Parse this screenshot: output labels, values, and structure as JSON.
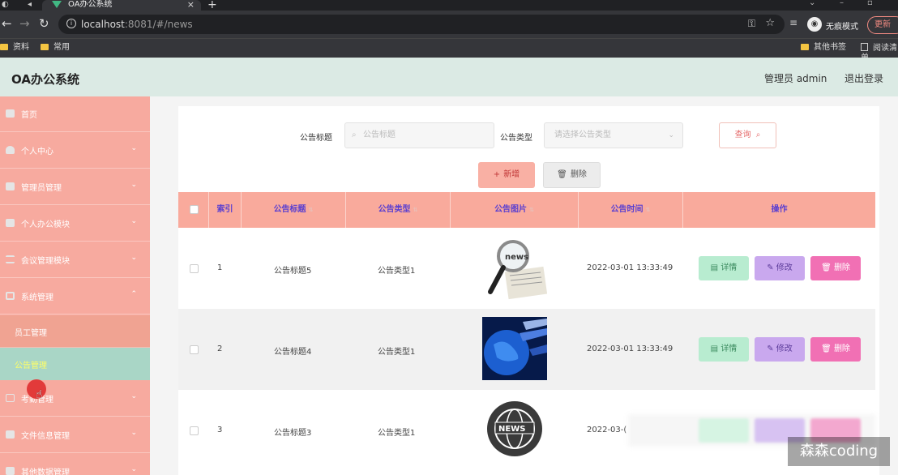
{
  "browser": {
    "tab_title": "OA办公系统",
    "url_host": "localhost",
    "url_rest": ":8081/#/news",
    "incognito_label": "无痕模式",
    "update_label": "更新",
    "bookmarks": [
      "资料",
      "常用"
    ],
    "bookmarks_right": [
      "其他书签",
      "阅读清单"
    ]
  },
  "header": {
    "title": "OA办公系统",
    "user": "管理员 admin",
    "logout": "退出登录"
  },
  "sidebar": {
    "items": [
      {
        "label": "首页",
        "icon": "home-icon"
      },
      {
        "label": "个人中心",
        "icon": "user-icon"
      },
      {
        "label": "管理员管理",
        "icon": "admin-icon"
      },
      {
        "label": "个人办公模块",
        "icon": "briefcase-icon"
      },
      {
        "label": "会议管理模块",
        "icon": "sliders-icon"
      },
      {
        "label": "系统管理",
        "icon": "system-icon"
      }
    ],
    "submenu": [
      "员工管理",
      "公告管理"
    ],
    "items_after": [
      {
        "label": "考勤管理",
        "icon": "image-icon"
      },
      {
        "label": "文件信息管理",
        "icon": "file-icon"
      },
      {
        "label": "其他数据管理",
        "icon": "folder-icon"
      }
    ]
  },
  "search": {
    "title_label": "公告标题",
    "title_placeholder": "公告标题",
    "type_label": "公告类型",
    "type_placeholder": "请选择公告类型",
    "query_button": "查询",
    "add_button": "新增",
    "delete_button": "删除"
  },
  "table": {
    "headers": {
      "index": "索引",
      "title": "公告标题",
      "type": "公告类型",
      "image": "公告图片",
      "time": "公告时间",
      "actions": "操作"
    },
    "rows": [
      {
        "index": "1",
        "title": "公告标题5",
        "type": "公告类型1",
        "image": "news-magnifier-image",
        "time": "2022-03-01 13:33:49"
      },
      {
        "index": "2",
        "title": "公告标题4",
        "type": "公告类型1",
        "image": "globe-image",
        "time": "2022-03-01 13:33:49"
      },
      {
        "index": "3",
        "title": "公告标题3",
        "type": "公告类型1",
        "image": "news-badge-image",
        "time": "2022-03-("
      }
    ],
    "actions": {
      "detail": "详情",
      "edit": "修改",
      "delete": "删除"
    }
  },
  "watermark": "森森coding",
  "colors": {
    "header_bg": "#dbeae4",
    "sidebar_bg": "#f7aa9f",
    "table_head_bg": "#f9aa9c",
    "header_text": "#5a3fd0",
    "detail_btn": "#b8ecd0",
    "edit_btn": "#c9a8ee",
    "delete_btn": "#f170b4",
    "active_submenu": "#a9d6c6"
  }
}
